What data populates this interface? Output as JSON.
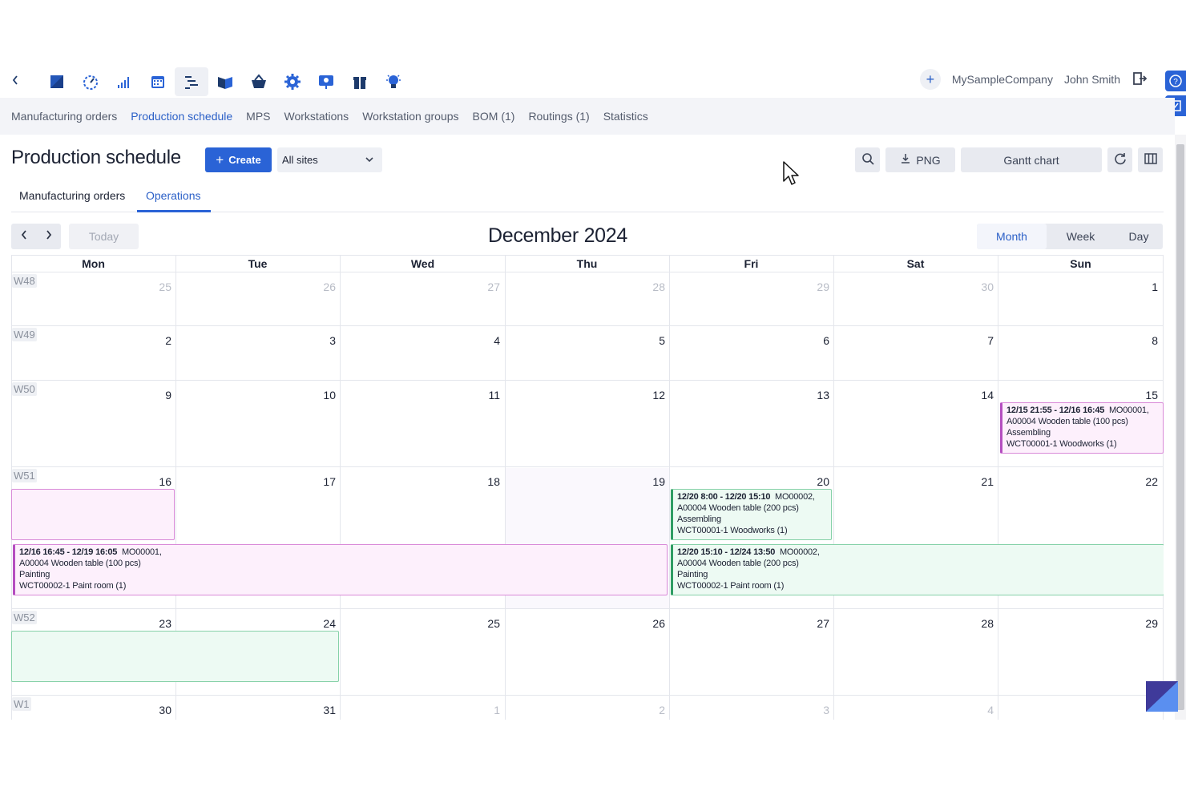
{
  "topbar": {
    "icons": [
      "back-arrow-icon",
      "brand-logo-icon",
      "dashboard-icon",
      "stats-icon",
      "calendar-icon",
      "production-icon",
      "book-icon",
      "basket-icon",
      "gear-icon",
      "presentation-icon",
      "gift-icon",
      "lightbulb-icon"
    ],
    "company": "MySampleCompany",
    "user": "John Smith"
  },
  "subnav": {
    "items": [
      "Manufacturing orders",
      "Production schedule",
      "MPS",
      "Workstations",
      "Workstation groups",
      "BOM (1)",
      "Routings (1)",
      "Statistics"
    ],
    "active": "Production schedule"
  },
  "header": {
    "title": "Production schedule",
    "create_label": "Create",
    "site_value": "All sites",
    "png_label": "PNG",
    "gantt_label": "Gantt chart"
  },
  "tabs": {
    "items": [
      "Manufacturing orders",
      "Operations"
    ],
    "active": "Operations"
  },
  "calendar": {
    "today_label": "Today",
    "title": "December 2024",
    "views": [
      "Month",
      "Week",
      "Day"
    ],
    "active_view": "Month",
    "weekdays": [
      "Mon",
      "Tue",
      "Wed",
      "Thu",
      "Fri",
      "Sat",
      "Sun"
    ],
    "weeks": [
      {
        "label": "W48",
        "days": [
          "25",
          "26",
          "27",
          "28",
          "29",
          "30",
          "1"
        ],
        "muted": [
          true,
          true,
          true,
          true,
          true,
          true,
          false
        ]
      },
      {
        "label": "W49",
        "days": [
          "2",
          "3",
          "4",
          "5",
          "6",
          "7",
          "8"
        ],
        "muted": [
          false,
          false,
          false,
          false,
          false,
          false,
          false
        ]
      },
      {
        "label": "W50",
        "days": [
          "9",
          "10",
          "11",
          "12",
          "13",
          "14",
          "15"
        ],
        "muted": [
          false,
          false,
          false,
          false,
          false,
          false,
          false
        ]
      },
      {
        "label": "W51",
        "days": [
          "16",
          "17",
          "18",
          "19",
          "20",
          "21",
          "22"
        ],
        "muted": [
          false,
          false,
          false,
          false,
          false,
          false,
          false
        ]
      },
      {
        "label": "W52",
        "days": [
          "23",
          "24",
          "25",
          "26",
          "27",
          "28",
          "29"
        ],
        "muted": [
          false,
          false,
          false,
          false,
          false,
          false,
          false
        ]
      },
      {
        "label": "W1",
        "days": [
          "30",
          "31",
          "1",
          "2",
          "3",
          "4"
        ],
        "muted": [
          false,
          false,
          true,
          true,
          true,
          true
        ]
      }
    ],
    "events": [
      {
        "time": "12/15 21:55 - 12/16 16:45",
        "mo": "MO00001,",
        "product": "A00004 Wooden table (100 pcs)",
        "operation": "Assembling",
        "workstation": "WCT00001-1 Woodworks (1)",
        "color": "pink"
      },
      {
        "time": "12/20 8:00 - 12/20 15:10",
        "mo": "MO00002,",
        "product": "A00004 Wooden table (200 pcs)",
        "operation": "Assembling",
        "workstation": "WCT00001-1 Woodworks (1)",
        "color": "green"
      },
      {
        "time": "12/16 16:45 - 12/19 16:05",
        "mo": "MO00001,",
        "product": "A00004 Wooden table (100 pcs)",
        "operation": "Painting",
        "workstation": "WCT00002-1 Paint room (1)",
        "color": "pink"
      },
      {
        "time": "12/20 15:10 - 12/24 13:50",
        "mo": "MO00002,",
        "product": "A00004 Wooden table (200 pcs)",
        "operation": "Painting",
        "workstation": "WCT00002-1 Paint room (1)",
        "color": "green"
      }
    ]
  },
  "colors": {
    "accent": "#2a63d6",
    "event_pink_bg": "#fdf0fc",
    "event_green_bg": "#edfaf3"
  }
}
